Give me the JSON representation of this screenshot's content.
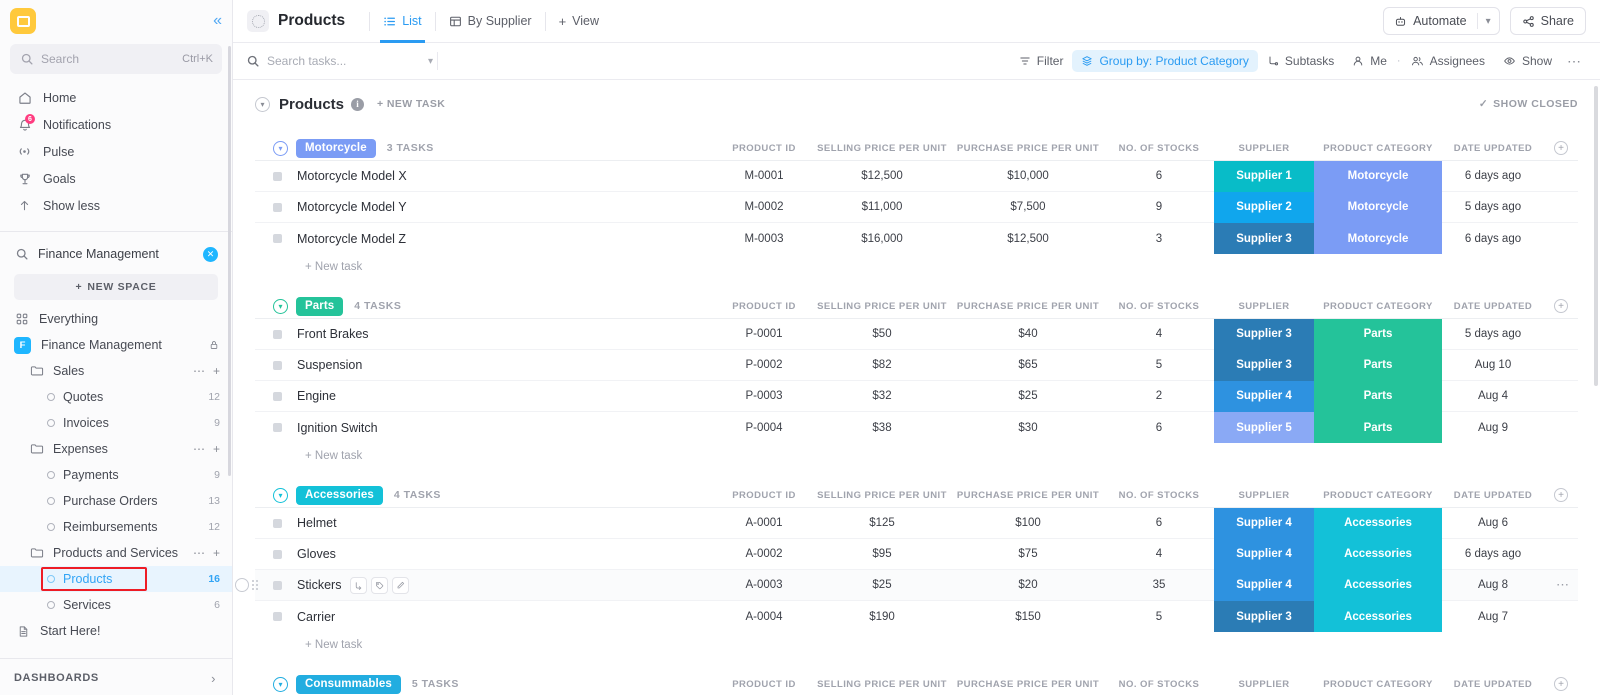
{
  "sidebar": {
    "logo_icon": "clickup-logo-icon",
    "collapse_icon": "chevron-double-left-icon",
    "search": {
      "placeholder": "Search",
      "shortcut": "Ctrl+K",
      "icon": "search-icon"
    },
    "nav": [
      {
        "label": "Home",
        "icon": "home-icon",
        "badge": ""
      },
      {
        "label": "Notifications",
        "icon": "bell-icon",
        "badge": "6"
      },
      {
        "label": "Pulse",
        "icon": "pulse-icon",
        "badge": ""
      },
      {
        "label": "Goals",
        "icon": "trophy-icon",
        "badge": ""
      },
      {
        "label": "Show less",
        "icon": "arrow-up-icon",
        "badge": ""
      }
    ],
    "space_search": {
      "value": "Finance Management",
      "icon": "search-icon",
      "clear_icon": "clear-x-icon"
    },
    "new_space_label": "NEW SPACE",
    "everything_label": "Everything",
    "space": {
      "initial": "F",
      "name": "Finance Management",
      "lock_icon": "lock-icon"
    },
    "tree": [
      {
        "type": "folder",
        "label": "Sales",
        "count": ""
      },
      {
        "type": "list",
        "label": "Quotes",
        "count": "12"
      },
      {
        "type": "list",
        "label": "Invoices",
        "count": "9"
      },
      {
        "type": "folder",
        "label": "Expenses",
        "count": ""
      },
      {
        "type": "list",
        "label": "Payments",
        "count": "9"
      },
      {
        "type": "list",
        "label": "Purchase Orders",
        "count": "13"
      },
      {
        "type": "list",
        "label": "Reimbursements",
        "count": "12"
      },
      {
        "type": "folder",
        "label": "Products and Services",
        "count": ""
      },
      {
        "type": "list",
        "label": "Products",
        "count": "16",
        "active": true,
        "highlighted": true
      },
      {
        "type": "list",
        "label": "Services",
        "count": "6"
      }
    ],
    "start_here_label": "Start Here!",
    "dashboards_label": "DASHBOARDS"
  },
  "topbar": {
    "list_name": "Products",
    "tabs": [
      {
        "label": "List",
        "icon": "list-icon",
        "active": true
      },
      {
        "label": "By Supplier",
        "icon": "table-icon",
        "active": false
      }
    ],
    "add_view_label": "View",
    "automate_label": "Automate",
    "automate_icon": "robot-icon",
    "share_label": "Share",
    "share_icon": "share-icon"
  },
  "filterbar": {
    "search_placeholder": "Search tasks...",
    "items": [
      {
        "label": "Filter",
        "icon": "filter-icon",
        "highlighted": false
      },
      {
        "label": "Group by: Product Category",
        "icon": "layers-icon",
        "highlighted": true
      },
      {
        "label": "Subtasks",
        "icon": "subtask-icon",
        "highlighted": false
      },
      {
        "label": "Me",
        "icon": "person-icon",
        "highlighted": false
      },
      {
        "label": "Assignees",
        "icon": "people-icon",
        "highlighted": false
      },
      {
        "label": "Show",
        "icon": "eye-icon",
        "highlighted": false
      },
      {
        "label": "",
        "icon": "more-horizontal-icon",
        "highlighted": false
      }
    ]
  },
  "list_header": {
    "title": "Products",
    "info_icon": "info-icon",
    "new_task_label": "+ NEW TASK",
    "show_closed_label": "SHOW CLOSED",
    "show_closed_icon": "check-icon"
  },
  "columns": [
    "PRODUCT ID",
    "SELLING PRICE PER UNIT",
    "PURCHASE PRICE PER UNIT",
    "NO. OF STOCKS",
    "SUPPLIER",
    "PRODUCT CATEGORY",
    "DATE UPDATED"
  ],
  "add_column_icon": "plus-circle-icon",
  "new_task_row_label": "+ New task",
  "colors": {
    "accent_blue": "#2a9bf2",
    "motorcycle": "#7b9cf5",
    "parts": "#24c39a",
    "accessories": "#13c1d8",
    "consummables": "#22ade0",
    "supplier_1": "#08bcc8",
    "supplier_2": "#10a6ed",
    "supplier_3": "#2b7cb5",
    "supplier_4": "#2e92e0",
    "supplier_5": "#8aa9f5",
    "highlight_red": "#ee1c25"
  },
  "groups": [
    {
      "name": "Motorcycle",
      "badge_color": "#7b9cf5",
      "chev_color": "#7b9cf5",
      "task_count": "3 TASKS",
      "rows": [
        {
          "name": "Motorcycle Model X",
          "product_id": "M-0001",
          "selling": "$12,500",
          "purchase": "$10,000",
          "stocks": "6",
          "supplier": "Supplier 1",
          "supplier_color": "#08bcc8",
          "category": "Motorcycle",
          "category_color": "#7b9cf5",
          "date": "6 days ago"
        },
        {
          "name": "Motorcycle Model Y",
          "product_id": "M-0002",
          "selling": "$11,000",
          "purchase": "$7,500",
          "stocks": "9",
          "supplier": "Supplier 2",
          "supplier_color": "#10a6ed",
          "category": "Motorcycle",
          "category_color": "#7b9cf5",
          "date": "5 days ago"
        },
        {
          "name": "Motorcycle Model Z",
          "product_id": "M-0003",
          "selling": "$16,000",
          "purchase": "$12,500",
          "stocks": "3",
          "supplier": "Supplier 3",
          "supplier_color": "#2b7cb5",
          "category": "Motorcycle",
          "category_color": "#7b9cf5",
          "date": "6 days ago"
        }
      ]
    },
    {
      "name": "Parts",
      "badge_color": "#24c39a",
      "chev_color": "#24c39a",
      "task_count": "4 TASKS",
      "rows": [
        {
          "name": "Front Brakes",
          "product_id": "P-0001",
          "selling": "$50",
          "purchase": "$40",
          "stocks": "4",
          "supplier": "Supplier 3",
          "supplier_color": "#2b7cb5",
          "category": "Parts",
          "category_color": "#24c39a",
          "date": "5 days ago"
        },
        {
          "name": "Suspension",
          "product_id": "P-0002",
          "selling": "$82",
          "purchase": "$65",
          "stocks": "5",
          "supplier": "Supplier 3",
          "supplier_color": "#2b7cb5",
          "category": "Parts",
          "category_color": "#24c39a",
          "date": "Aug 10"
        },
        {
          "name": "Engine",
          "product_id": "P-0003",
          "selling": "$32",
          "purchase": "$25",
          "stocks": "2",
          "supplier": "Supplier 4",
          "supplier_color": "#2e92e0",
          "category": "Parts",
          "category_color": "#24c39a",
          "date": "Aug 4"
        },
        {
          "name": "Ignition Switch",
          "product_id": "P-0004",
          "selling": "$38",
          "purchase": "$30",
          "stocks": "6",
          "supplier": "Supplier 5",
          "supplier_color": "#8aa9f5",
          "category": "Parts",
          "category_color": "#24c39a",
          "date": "Aug 9"
        }
      ]
    },
    {
      "name": "Accessories",
      "badge_color": "#13c1d8",
      "chev_color": "#13c1d8",
      "task_count": "4 TASKS",
      "rows": [
        {
          "name": "Helmet",
          "product_id": "A-0001",
          "selling": "$125",
          "purchase": "$100",
          "stocks": "6",
          "supplier": "Supplier 4",
          "supplier_color": "#2e92e0",
          "category": "Accessories",
          "category_color": "#13c1d8",
          "date": "Aug 6"
        },
        {
          "name": "Gloves",
          "product_id": "A-0002",
          "selling": "$95",
          "purchase": "$75",
          "stocks": "4",
          "supplier": "Supplier 4",
          "supplier_color": "#2e92e0",
          "category": "Accessories",
          "category_color": "#13c1d8",
          "date": "6 days ago"
        },
        {
          "name": "Stickers",
          "product_id": "A-0003",
          "selling": "$25",
          "purchase": "$20",
          "stocks": "35",
          "supplier": "Supplier 4",
          "supplier_color": "#2e92e0",
          "category": "Accessories",
          "category_color": "#13c1d8",
          "date": "Aug 8",
          "hovered": true
        },
        {
          "name": "Carrier",
          "product_id": "A-0004",
          "selling": "$190",
          "purchase": "$150",
          "stocks": "5",
          "supplier": "Supplier 3",
          "supplier_color": "#2b7cb5",
          "category": "Accessories",
          "category_color": "#13c1d8",
          "date": "Aug 7"
        }
      ]
    },
    {
      "name": "Consummables",
      "badge_color": "#22ade0",
      "chev_color": "#22ade0",
      "task_count": "5 TASKS",
      "rows": []
    }
  ],
  "row_hover_icons": [
    "subtask-link-icon",
    "tag-icon",
    "edit-pencil-icon"
  ],
  "row_more_icon": "more-horizontal-icon"
}
